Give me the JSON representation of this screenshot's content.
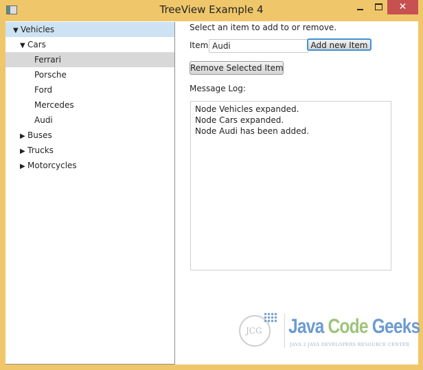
{
  "window": {
    "title": "TreeView Example 4",
    "icons": {
      "app": "app-window-icon",
      "minimize": "minimize-icon",
      "maximize": "maximize-icon",
      "close": "close-icon"
    },
    "close_glyph": "✕"
  },
  "tree": {
    "expanded_glyph": "▼",
    "collapsed_glyph": "▶",
    "items": [
      {
        "label": "Vehicles",
        "level": 0,
        "state": "expanded",
        "selected": true
      },
      {
        "label": "Cars",
        "level": 1,
        "state": "expanded"
      },
      {
        "label": "Ferrari",
        "level": 2,
        "state": "leaf",
        "hover": true
      },
      {
        "label": "Porsche",
        "level": 2,
        "state": "leaf"
      },
      {
        "label": "Ford",
        "level": 2,
        "state": "leaf"
      },
      {
        "label": "Mercedes",
        "level": 2,
        "state": "leaf"
      },
      {
        "label": "Audi",
        "level": 2,
        "state": "leaf"
      },
      {
        "label": "Buses",
        "level": 1,
        "state": "collapsed"
      },
      {
        "label": "Trucks",
        "level": 1,
        "state": "collapsed"
      },
      {
        "label": "Motorcycles",
        "level": 1,
        "state": "collapsed"
      }
    ]
  },
  "form": {
    "instruction": "Select an item to add to or remove.",
    "item_label": "Item:",
    "item_value": "Audi",
    "add_button": "Add new Item",
    "remove_button": "Remove Selected Item",
    "log_label": "Message Log:",
    "log_lines": [
      "Node Vehicles expanded.",
      "Node Cars expanded.",
      "Node Audi has been added."
    ]
  },
  "watermark": {
    "emblem": "JCG",
    "word1": "Java",
    "word2": "Code",
    "word3": "Geeks",
    "tagline": "JAVA 2 JAVA DEVELOPERS RESOURCE CENTER"
  },
  "colors": {
    "frame": "#efc76a",
    "close": "#c75050",
    "selection": "#cde3f3",
    "hover": "#d8d8d8",
    "focus": "#3c93d6"
  }
}
